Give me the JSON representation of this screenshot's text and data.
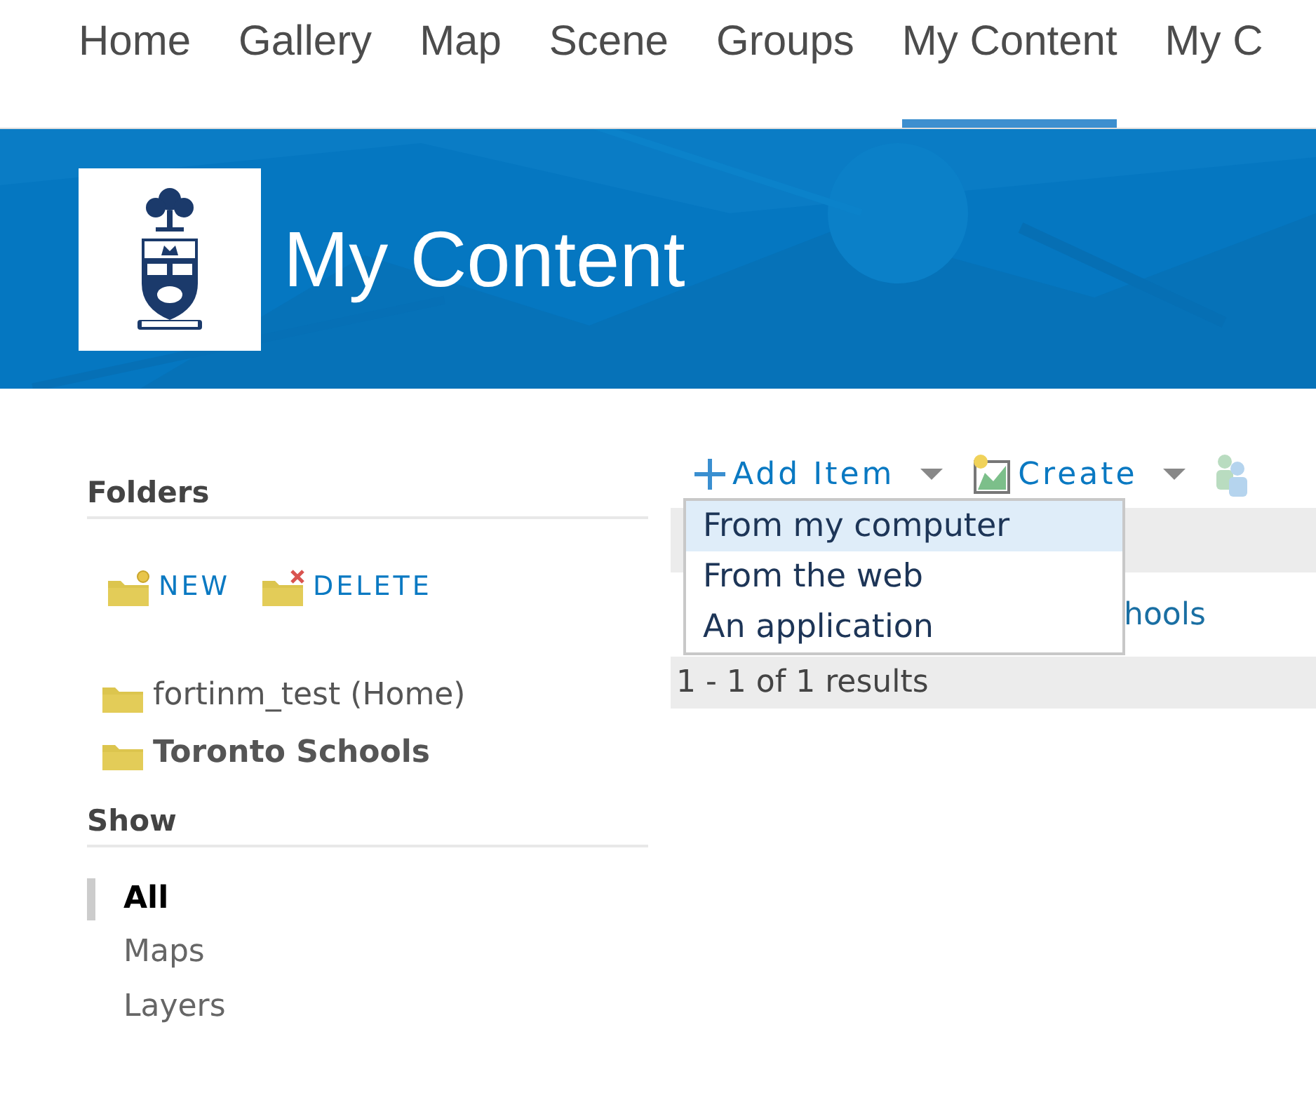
{
  "nav_tabs": [
    {
      "label": "Home",
      "selected": false
    },
    {
      "label": "Gallery",
      "selected": false
    },
    {
      "label": "Map",
      "selected": false
    },
    {
      "label": "Scene",
      "selected": false
    },
    {
      "label": "Groups",
      "selected": false
    },
    {
      "label": "My Content",
      "selected": true
    },
    {
      "label": "My C",
      "selected": false
    }
  ],
  "header": {
    "title": "My Content"
  },
  "folders": {
    "heading": "Folders",
    "actions": [
      {
        "kind": "new",
        "label": "NEW"
      },
      {
        "kind": "delete",
        "label": "DELETE"
      }
    ],
    "items": [
      {
        "label": "fortinm_test (Home)",
        "selected": false
      },
      {
        "label": "Toronto Schools",
        "selected": true
      }
    ]
  },
  "show": {
    "heading": "Show",
    "items": [
      {
        "label": "All",
        "selected": true
      },
      {
        "label": "Maps",
        "selected": false
      },
      {
        "label": "Layers",
        "selected": false
      }
    ]
  },
  "toolbar": [
    {
      "kind": "add",
      "label": "Add Item"
    },
    {
      "kind": "create",
      "label": "Create"
    },
    {
      "kind": "share"
    }
  ],
  "add_menu": {
    "items": [
      {
        "label": "From my computer",
        "selected": true
      },
      {
        "label": "From the web",
        "selected": false
      },
      {
        "label": "An application",
        "selected": false
      }
    ]
  },
  "table": {
    "rows": [
      {
        "title": "hools"
      }
    ],
    "footer": "1 - 1 of 1 results"
  }
}
